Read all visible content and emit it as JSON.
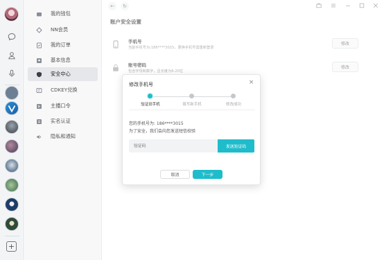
{
  "rail": {
    "icons": [
      {
        "name": "chat-icon"
      },
      {
        "name": "contacts-icon"
      },
      {
        "name": "microphone-icon"
      }
    ],
    "rooms": [
      {
        "name": "room-avatar-1",
        "color": "#6c7f93"
      },
      {
        "name": "room-avatar-2",
        "color": "#2a8ed6"
      },
      {
        "name": "room-avatar-3",
        "color": "#3a3f46"
      },
      {
        "name": "room-avatar-4",
        "color": "#4a3b52"
      },
      {
        "name": "room-avatar-5",
        "color": "#2f4f70"
      },
      {
        "name": "room-avatar-6",
        "color": "#3c6a4a"
      },
      {
        "name": "room-avatar-7",
        "color": "#1c3d6b"
      },
      {
        "name": "room-avatar-8",
        "color": "#2f4a3a"
      }
    ],
    "add_label": "+"
  },
  "menu": {
    "items": [
      {
        "label": "我的钱包",
        "icon": "wallet-icon",
        "active": false
      },
      {
        "label": "NN会员",
        "icon": "vip-icon",
        "active": false
      },
      {
        "label": "我的订单",
        "icon": "order-icon",
        "active": false
      },
      {
        "label": "基本信息",
        "icon": "profile-icon",
        "active": false
      },
      {
        "label": "安全中心",
        "icon": "shield-icon",
        "active": true
      },
      {
        "label": "CDKEY兑换",
        "icon": "key-icon",
        "active": false
      },
      {
        "label": "主播口令",
        "icon": "command-icon",
        "active": false
      },
      {
        "label": "实名认证",
        "icon": "id-card-icon",
        "active": false
      },
      {
        "label": "隐私和通知",
        "icon": "speaker-icon",
        "active": false
      }
    ]
  },
  "nav": {
    "back": "←",
    "refresh": "↻"
  },
  "page": {
    "title": "账户安全设置",
    "rows": [
      {
        "title": "手机号",
        "desc": "当前手机号为:186****3015，更换手机号需重新登录",
        "button": "修改",
        "icon": "phone-icon"
      },
      {
        "title": "账号密码",
        "desc": "包含字母和数字，且长度为6-20位",
        "button": "修改",
        "icon": "lock-icon"
      }
    ]
  },
  "dialog": {
    "title": "修改手机号",
    "close": "×",
    "steps": [
      "验证旧手机",
      "填写新手机",
      "修改成功"
    ],
    "current_step": 1,
    "info_line1": "您的手机号为: 186****3015",
    "info_line2": "为了安全，我们会向您发送短信校验",
    "code_placeholder": "验证码",
    "send_button": "发送验证码",
    "cancel_button": "取消",
    "next_button": "下一步"
  },
  "colors": {
    "accent": "#1fbccb"
  }
}
